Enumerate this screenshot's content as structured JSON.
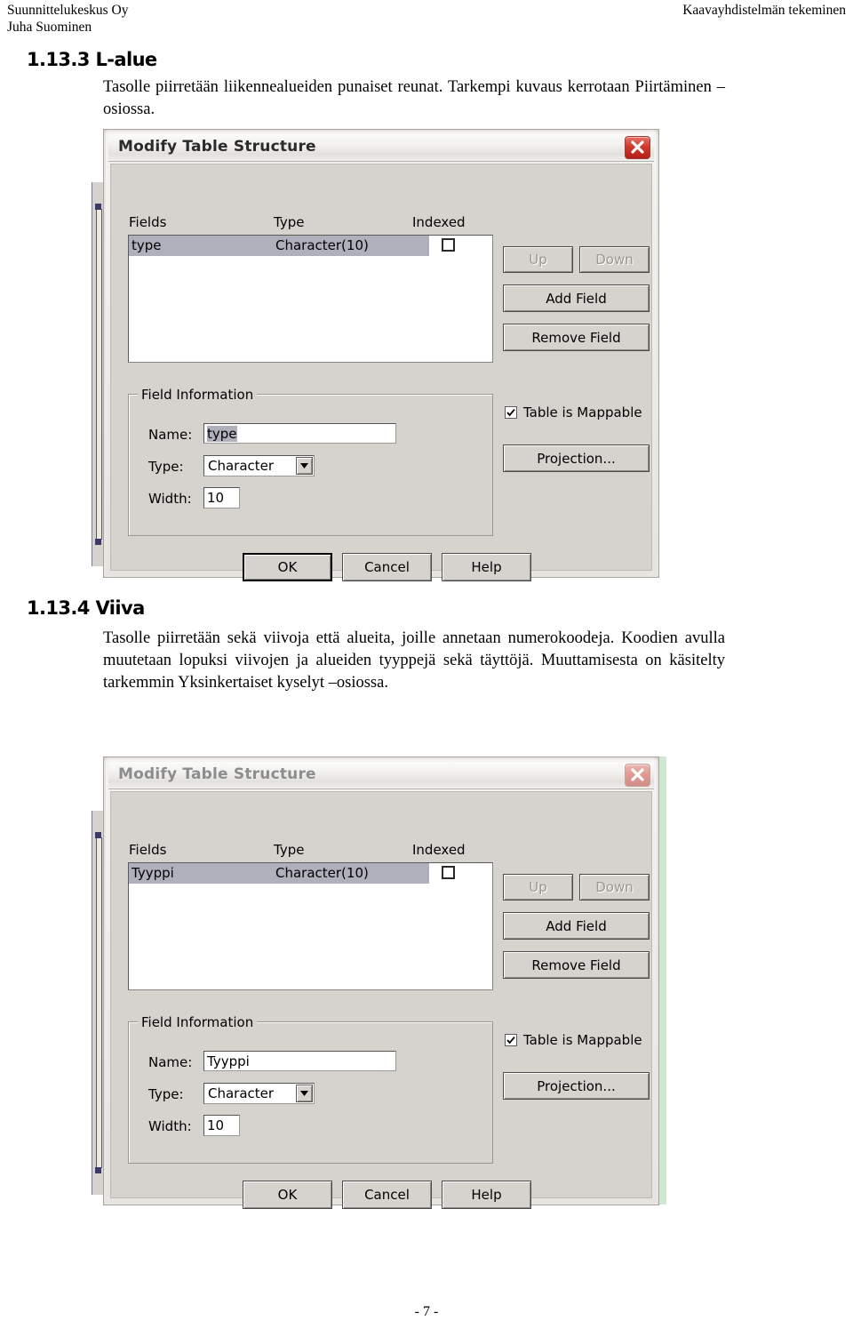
{
  "header": {
    "company": "Suunnittelukeskus Oy",
    "author": "Juha Suominen",
    "doc_title": "Kaavayhdistelmän tekeminen"
  },
  "sections": [
    {
      "number": "1.13.3",
      "heading": "1.13.3 L-alue",
      "body": "Tasolle piirretään liikennealueiden punaiset reunat. Tarkempi kuvaus kerrotaan Piirtäminen –osiossa."
    },
    {
      "number": "1.13.4",
      "heading": "1.13.4 Viiva",
      "body": "Tasolle piirretään sekä viivoja että alueita, joille annetaan numerokoodeja. Koodien avulla muutetaan lopuksi viivojen ja alueiden tyyppejä sekä täyttöjä. Muuttamisesta on käsitelty tarkemmin Yksinkertaiset kyselyt –osiossa."
    }
  ],
  "dialog1": {
    "title": "Modify Table Structure",
    "close_icon": "close-icon",
    "columns": {
      "fields": "Fields",
      "type": "Type",
      "indexed": "Indexed"
    },
    "rows": [
      {
        "name": "type",
        "type": "Character(10)",
        "indexed": false
      }
    ],
    "buttons": {
      "up": "Up",
      "down": "Down",
      "add_field": "Add Field",
      "remove_field": "Remove Field",
      "ok": "OK",
      "cancel": "Cancel",
      "help": "Help",
      "projection": "Projection..."
    },
    "field_information": {
      "group_title": "Field Information",
      "name_label": "Name:",
      "name_value": "type",
      "type_label": "Type:",
      "type_value": "Character",
      "width_label": "Width:",
      "width_value": "10"
    },
    "table_is_mappable": {
      "label": "Table is Mappable",
      "checked": true
    }
  },
  "dialog2": {
    "title": "Modify Table Structure",
    "close_icon": "close-icon",
    "columns": {
      "fields": "Fields",
      "type": "Type",
      "indexed": "Indexed"
    },
    "rows": [
      {
        "name": "Tyyppi",
        "type": "Character(10)",
        "indexed": false
      }
    ],
    "buttons": {
      "up": "Up",
      "down": "Down",
      "add_field": "Add Field",
      "remove_field": "Remove Field",
      "ok": "OK",
      "cancel": "Cancel",
      "help": "Help",
      "projection": "Projection..."
    },
    "field_information": {
      "group_title": "Field Information",
      "name_label": "Name:",
      "name_value": "Tyyppi",
      "type_label": "Type:",
      "type_value": "Character",
      "width_label": "Width:",
      "width_value": "10"
    },
    "table_is_mappable": {
      "label": "Table is Mappable",
      "checked": true
    }
  },
  "footer": {
    "page_number": "- 7 -"
  },
  "colors": {
    "dialog_face": "#d6d3ce",
    "selection": "#b0b0bc",
    "close_red": "#c8342a",
    "green_edge": "#cfe8cf"
  }
}
